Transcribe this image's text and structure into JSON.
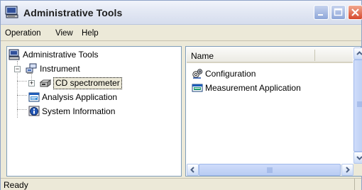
{
  "window": {
    "title": "Administrative Tools",
    "title_icon": "computer-console-icon"
  },
  "menu": [
    "Operation",
    "View",
    "Help"
  ],
  "tree": {
    "root": {
      "label": "Administrative Tools",
      "icon": "computer-console-icon"
    },
    "instrument": {
      "label": "Instrument",
      "icon": "network-computers-icon",
      "expander": "−"
    },
    "cd_spectrometer": {
      "label": "CD spectrometer",
      "icon": "device-icon",
      "expander": "+"
    },
    "analysis": {
      "label": "Analysis Application",
      "icon": "application-window-icon"
    },
    "sysinfo": {
      "label": "System Information",
      "icon": "info-icon"
    }
  },
  "list": {
    "header_name": "Name",
    "items": [
      {
        "label": "Configuration",
        "icon": "gears-icon"
      },
      {
        "label": "Measurement Application",
        "icon": "application-window-icon"
      }
    ]
  },
  "status": {
    "text": "Ready"
  }
}
